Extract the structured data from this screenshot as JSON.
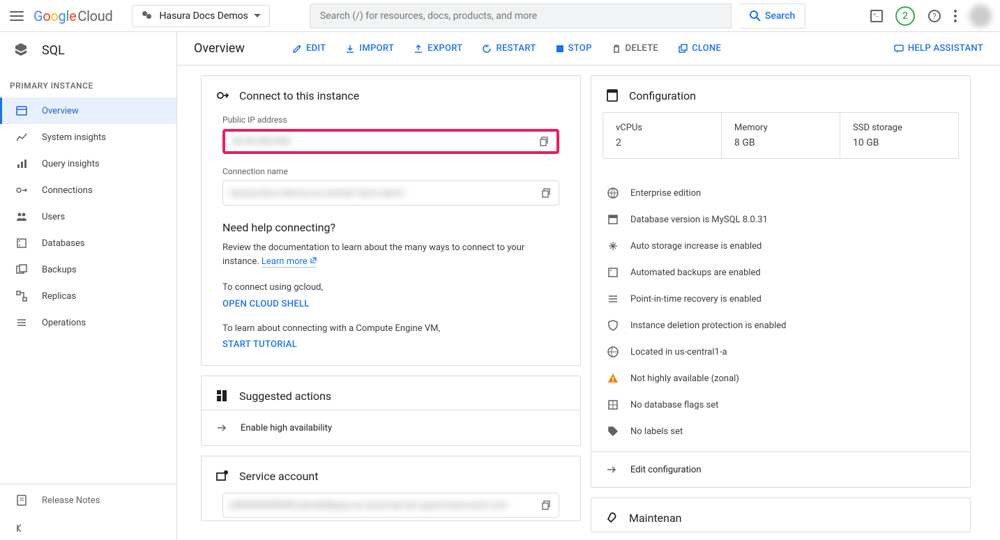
{
  "header": {
    "logo_suffix": "Cloud",
    "project": "Hasura Docs Demos",
    "search_placeholder": "Search (/) for resources, docs, products, and more",
    "search_button": "Search",
    "badge_count": "2"
  },
  "sidebar": {
    "product": "SQL",
    "section_label": "PRIMARY INSTANCE",
    "items": [
      {
        "label": "Overview"
      },
      {
        "label": "System insights"
      },
      {
        "label": "Query insights"
      },
      {
        "label": "Connections"
      },
      {
        "label": "Users"
      },
      {
        "label": "Databases"
      },
      {
        "label": "Backups"
      },
      {
        "label": "Replicas"
      },
      {
        "label": "Operations"
      }
    ],
    "release_notes": "Release Notes"
  },
  "toolbar": {
    "title": "Overview",
    "edit": "EDIT",
    "import": "IMPORT",
    "export": "EXPORT",
    "restart": "RESTART",
    "stop": "STOP",
    "delete": "DELETE",
    "clone": "CLONE",
    "help_assistant": "HELP ASSISTANT"
  },
  "connect": {
    "title": "Connect to this instance",
    "public_ip_label": "Public IP address",
    "conn_name_label": "Connection name",
    "need_help": "Need help connecting?",
    "help_text": "Review the documentation to learn about the many ways to connect to your instance.",
    "learn_more": "Learn more",
    "gcloud": "To connect using gcloud,",
    "open_shell": "OPEN CLOUD SHELL",
    "vm": "To learn about connecting with a Compute Engine VM,",
    "tutorial": "START TUTORIAL"
  },
  "suggested": {
    "title": "Suggested actions",
    "enable_ha": "Enable high availability"
  },
  "service_account": {
    "title": "Service account"
  },
  "config": {
    "title": "Configuration",
    "stats": [
      {
        "label": "vCPUs",
        "value": "2"
      },
      {
        "label": "Memory",
        "value": "8 GB"
      },
      {
        "label": "SSD storage",
        "value": "10 GB"
      }
    ],
    "items": [
      "Enterprise edition",
      "Database version is MySQL 8.0.31",
      "Auto storage increase is enabled",
      "Automated backups are enabled",
      "Point-in-time recovery is enabled",
      "Instance deletion protection is enabled",
      "Located in us-central1-a",
      "Not highly available (zonal)",
      "No database flags set",
      "No labels set"
    ],
    "edit": "Edit configuration"
  },
  "maintenance": {
    "title": "Maintenan"
  }
}
